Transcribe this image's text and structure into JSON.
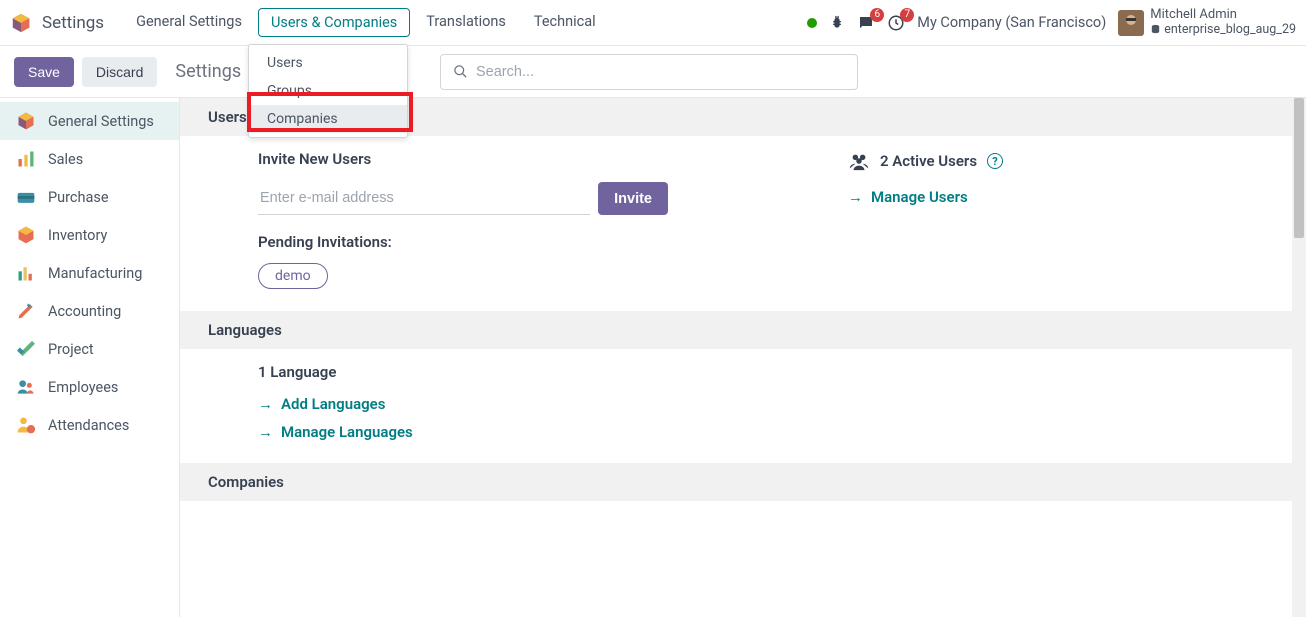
{
  "app_title": "Settings",
  "top_menu": {
    "general": "General Settings",
    "users_companies": "Users & Companies",
    "translations": "Translations",
    "technical": "Technical"
  },
  "notif": {
    "chat": "6",
    "clock": "7"
  },
  "company": "My Company (San Francisco)",
  "user": {
    "name": "Mitchell Admin",
    "db": "enterprise_blog_aug_29"
  },
  "dropdown": {
    "users": "Users",
    "groups": "Groups",
    "companies": "Companies"
  },
  "actions": {
    "save": "Save",
    "discard": "Discard"
  },
  "breadcrumb": "Settings",
  "search": {
    "placeholder": "Search..."
  },
  "sidebar": {
    "general": "General Settings",
    "sales": "Sales",
    "purchase": "Purchase",
    "inventory": "Inventory",
    "manufacturing": "Manufacturing",
    "accounting": "Accounting",
    "project": "Project",
    "employees": "Employees",
    "attendances": "Attendances"
  },
  "sections": {
    "users": {
      "title": "Users",
      "invite_title": "Invite New Users",
      "invite_placeholder": "Enter e-mail address",
      "invite_btn": "Invite",
      "pending": "Pending Invitations:",
      "pending_pill": "demo",
      "active_users": "2 Active Users",
      "manage_users": "Manage Users"
    },
    "languages": {
      "title": "Languages",
      "count": "1 Language",
      "add": "Add Languages",
      "manage": "Manage Languages"
    },
    "companies": {
      "title": "Companies"
    }
  }
}
